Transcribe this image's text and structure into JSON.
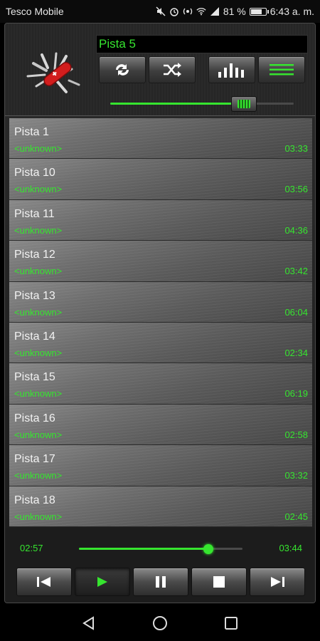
{
  "status_bar": {
    "carrier": "Tesco Mobile",
    "battery_percent": "81 %",
    "battery_level": 0.81,
    "time": "6:43 a. m."
  },
  "header": {
    "current_track": "Pista 5",
    "volume_level": 0.73,
    "buttons": [
      "repeat",
      "shuffle",
      "equalizer",
      "playlist"
    ]
  },
  "playlist": [
    {
      "title": "Pista 1",
      "artist": "<unknown>",
      "duration": "03:33"
    },
    {
      "title": "Pista 10",
      "artist": "<unknown>",
      "duration": "03:56"
    },
    {
      "title": "Pista 11",
      "artist": "<unknown>",
      "duration": "04:36"
    },
    {
      "title": "Pista 12",
      "artist": "<unknown>",
      "duration": "03:42"
    },
    {
      "title": "Pista 13",
      "artist": "<unknown>",
      "duration": "06:04"
    },
    {
      "title": "Pista 14",
      "artist": "<unknown>",
      "duration": "02:34"
    },
    {
      "title": "Pista 15",
      "artist": "<unknown>",
      "duration": "06:19"
    },
    {
      "title": "Pista 16",
      "artist": "<unknown>",
      "duration": "02:58"
    },
    {
      "title": "Pista 17",
      "artist": "<unknown>",
      "duration": "03:32"
    },
    {
      "title": "Pista 18",
      "artist": "<unknown>",
      "duration": "02:45"
    }
  ],
  "progress": {
    "elapsed": "02:57",
    "total": "03:44",
    "fraction": 0.79
  },
  "transport": [
    "previous",
    "play",
    "pause",
    "stop",
    "next"
  ],
  "colors": {
    "accent": "#36e52f",
    "panel": "#1c1c1c"
  }
}
